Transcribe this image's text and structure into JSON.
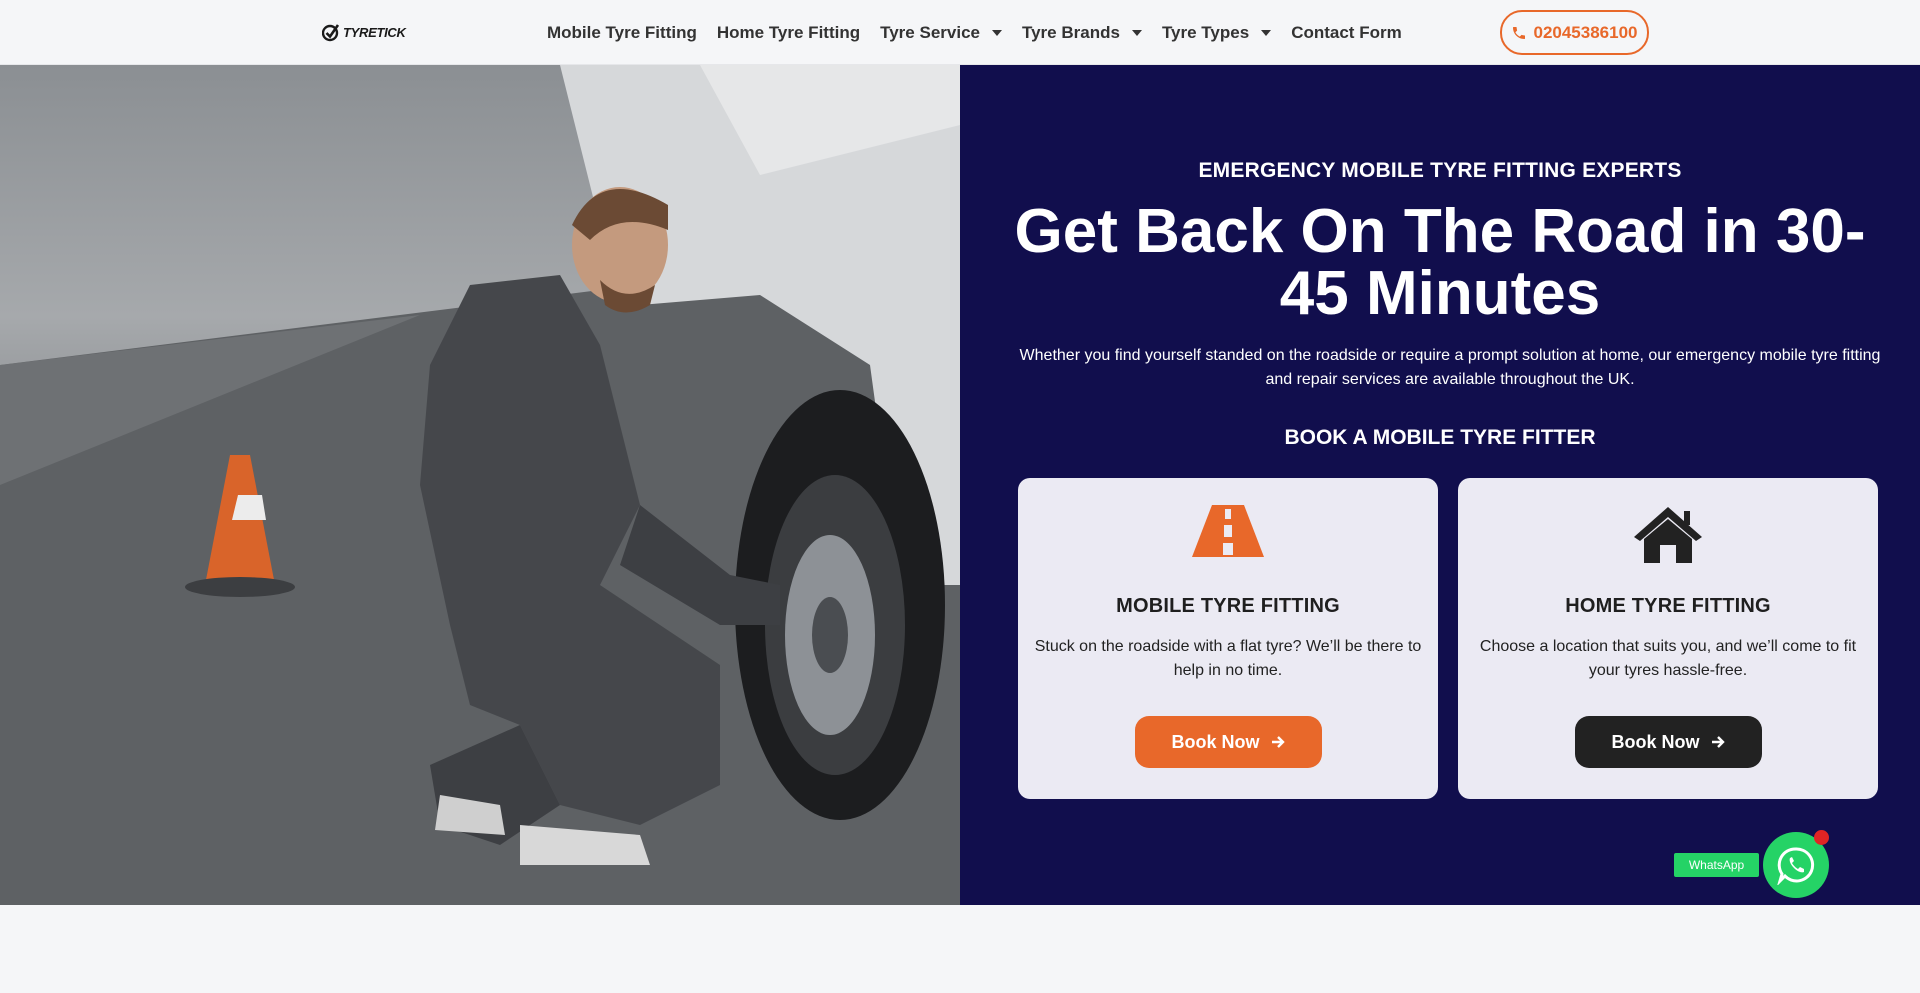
{
  "header": {
    "logo_text": "TYRETICK",
    "nav": [
      {
        "label": "Mobile Tyre Fitting",
        "dropdown": false
      },
      {
        "label": "Home Tyre Fitting",
        "dropdown": false
      },
      {
        "label": "Tyre Service",
        "dropdown": true
      },
      {
        "label": "Tyre Brands",
        "dropdown": true
      },
      {
        "label": "Tyre Types",
        "dropdown": true
      },
      {
        "label": "Contact Form",
        "dropdown": false
      }
    ],
    "phone": "02045386100"
  },
  "hero": {
    "eyebrow": "EMERGENCY MOBILE TYRE FITTING EXPERTS",
    "headline": "Get Back On The Road in 30-45 Minutes",
    "intro": "Whether you find yourself standed on the roadside or require a prompt solution at home, our emergency mobile tyre fitting and repair services are available throughout the UK.",
    "section_label": "BOOK A MOBILE TYRE FITTER",
    "cards": [
      {
        "icon": "road-icon",
        "title": "MOBILE TYRE FITTING",
        "text": "Stuck on the roadside with a flat tyre? We’ll be there to help in no time.",
        "button": "Book Now",
        "button_color": "#e8682a",
        "icon_color": "#e8682a"
      },
      {
        "icon": "home-icon",
        "title": "HOME TYRE FITTING",
        "text": "Choose a location that suits you, and we’ll come to fit your tyres hassle-free.",
        "button": "Book Now",
        "button_color": "#222222",
        "icon_color": "#222222"
      }
    ]
  },
  "whatsapp": {
    "label": "WhatsApp"
  },
  "colors": {
    "accent": "#e8682a",
    "navy": "#110e4d",
    "whatsapp": "#25d366"
  }
}
